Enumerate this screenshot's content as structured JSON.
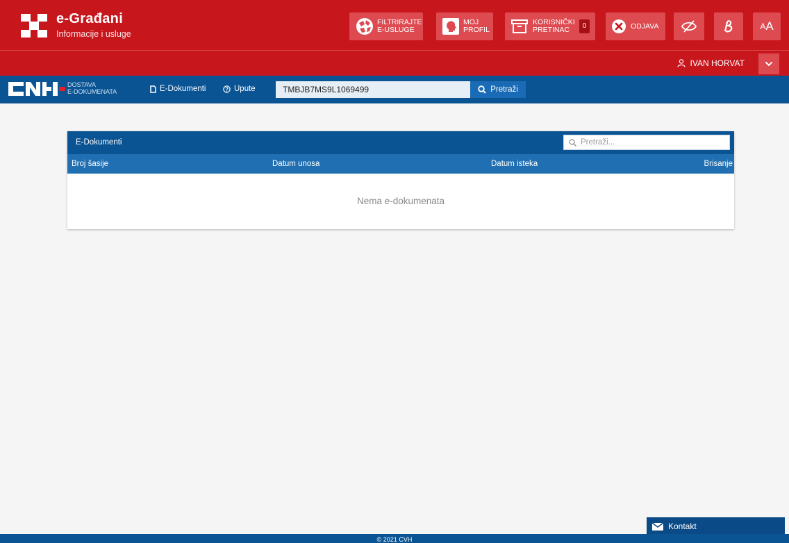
{
  "brand": {
    "title": "e-Građani",
    "subtitle": "Informacije i usluge"
  },
  "header_buttons": {
    "filter": "FILTRIRAJTE\nE-USLUGE",
    "profile": "MOJ\nPROFIL",
    "inbox": "KORISNIČKI\nPRETINAC",
    "inbox_count": "0",
    "logout": "ODJAVA",
    "font_size": "AA"
  },
  "user": {
    "name": "IVAN HORVAT"
  },
  "nav": {
    "app_sub_line1": "DOSTAVA",
    "app_sub_line2": "E-DOKUMENATA",
    "link_documents": "E-Dokumenti",
    "link_help": "Upute",
    "search_value": "TMBJB7MS9L1069499",
    "search_button": "Pretraži"
  },
  "card": {
    "title": "E-Dokumenti",
    "search_placeholder": "Pretraži...",
    "columns": [
      "Broj šasije",
      "Datum unosa",
      "Datum isteka",
      "Brisanje"
    ],
    "empty_message": "Nema e-dokumenata"
  },
  "footer": {
    "copyright": "© 2021 CVH",
    "contact": "Kontakt"
  },
  "colors": {
    "red": "#c8161d",
    "blue": "#0a5494",
    "table_header": "#1f6fb2"
  }
}
